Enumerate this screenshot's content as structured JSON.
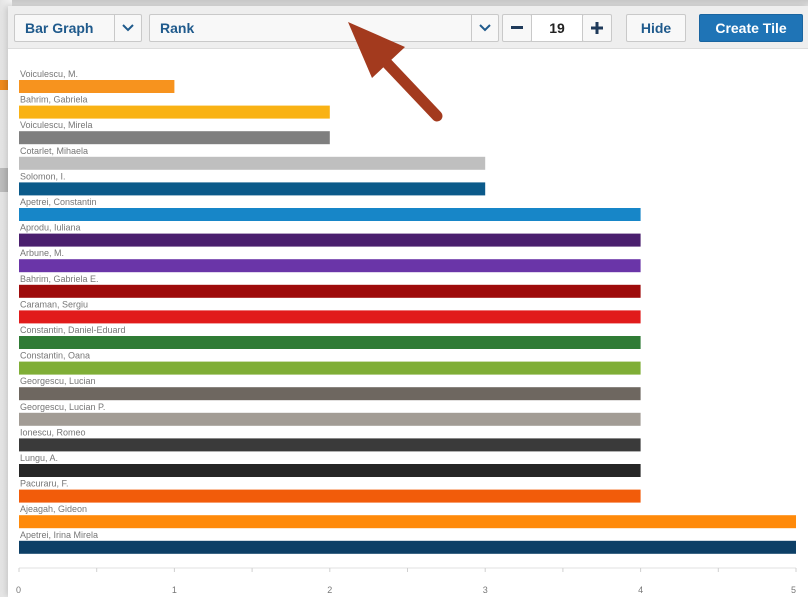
{
  "toolbar": {
    "chart_type_label": "Bar Graph",
    "metric_label": "Rank",
    "stepper_minus": "−",
    "stepper_value": "19",
    "stepper_plus": "+",
    "hide_label": "Hide",
    "create_tile_label": "Create Tile"
  },
  "colors": {
    "accent": "#1f74b6",
    "arrow": "#a33a1e"
  },
  "icons": {
    "caret": "chevron-down-icon",
    "arrow": "arrow-annotation-icon"
  },
  "chart_data": {
    "type": "bar",
    "orientation": "horizontal",
    "categories": [
      "Voiculescu, M.",
      "Bahrim, Gabriela",
      "Voiculescu, Mirela",
      "Cotarlet, Mihaela",
      "Solomon, I.",
      "Apetrei, Constantin",
      "Aprodu, Iuliana",
      "Arbune, M.",
      "Bahrim, Gabriela E.",
      "Caraman, Sergiu",
      "Constantin, Daniel-Eduard",
      "Constantin, Oana",
      "Georgescu, Lucian",
      "Georgescu, Lucian P.",
      "Ionescu, Romeo",
      "Lungu, A.",
      "Pacuraru, F.",
      "Ajeagah, Gideon",
      "Apetrei, Irina Mirela"
    ],
    "values": [
      1,
      2,
      2,
      3,
      3,
      4,
      4,
      4,
      4,
      4,
      4,
      4,
      4,
      4,
      4,
      4,
      4,
      5,
      5
    ],
    "bar_colors": [
      "#f7931e",
      "#f9b214",
      "#7f7f7f",
      "#bfbfbf",
      "#0b5a8a",
      "#1786c8",
      "#4a1f6e",
      "#6a35a8",
      "#9e0b0b",
      "#e11b1b",
      "#2f7b35",
      "#7fae36",
      "#6e6760",
      "#a29c95",
      "#3a3a3a",
      "#262626",
      "#f25c0a",
      "#ff8a0a",
      "#0d3f66"
    ],
    "x_ticks": [
      "0",
      "1",
      "2",
      "3",
      "4",
      "5"
    ],
    "xlim": [
      0,
      5
    ],
    "grid": false
  }
}
